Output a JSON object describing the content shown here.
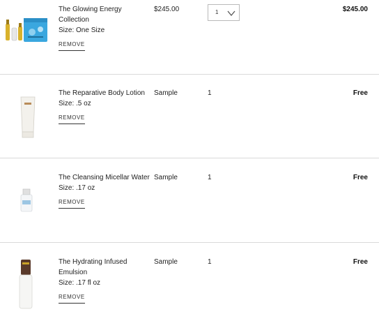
{
  "items": [
    {
      "name": "The Glowing Energy Collection",
      "size": "Size: One Size",
      "remove": "REMOVE",
      "price": "$245.00",
      "quantity": "1",
      "total": "$245.00",
      "image_icon": "gift-set-product-image"
    },
    {
      "name": "The Reparative Body Lotion",
      "size": "Size: .5 oz",
      "remove": "REMOVE",
      "price": "Sample",
      "quantity": "1",
      "total": "Free",
      "image_icon": "lotion-tube-image"
    },
    {
      "name": "The Cleansing Micellar Water",
      "size": "Size: .17 oz",
      "remove": "REMOVE",
      "price": "Sample",
      "quantity": "1",
      "total": "Free",
      "image_icon": "mini-bottle-image"
    },
    {
      "name": "The Hydrating Infused Emulsion",
      "size": "Size: .17 fl oz",
      "remove": "REMOVE",
      "price": "Sample",
      "quantity": "1",
      "total": "Free",
      "image_icon": "pump-bottle-image"
    }
  ],
  "colors": {
    "divider": "#d9d9d9",
    "text": "#222222",
    "select_border": "#b9b9b9",
    "gift_blue": "#3aa7df",
    "gold": "#c9a227"
  }
}
